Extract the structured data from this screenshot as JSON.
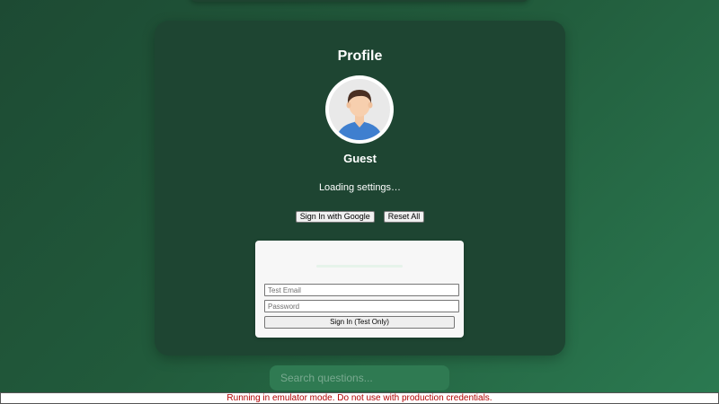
{
  "profile": {
    "title": "Profile",
    "username": "Guest",
    "status_text": "Loading settings…",
    "avatar_icon": "user-avatar-icon"
  },
  "actions": {
    "google_sign_in_label": "Sign In with Google",
    "reset_label": "Reset All"
  },
  "test_login": {
    "email_placeholder": "Test Email",
    "email_value": "",
    "password_placeholder": "Password",
    "password_value": "",
    "submit_label": "Sign In (Test Only)"
  },
  "search": {
    "placeholder": "Search questions...",
    "value": ""
  },
  "banner": {
    "text": "Running in emulator mode. Do not use with production credentials.",
    "color": "#b00000"
  },
  "colors": {
    "card_background": "#1e4532",
    "page_gradient_start": "#1d4a33",
    "page_gradient_end": "#2b7a51"
  }
}
